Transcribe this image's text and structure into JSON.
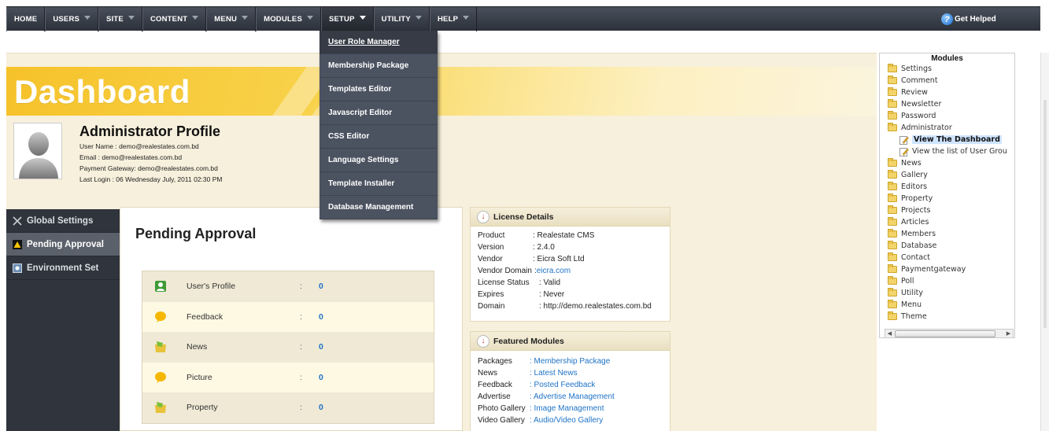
{
  "nav": {
    "items": [
      {
        "label": "HOME",
        "caret": false
      },
      {
        "label": "USERS",
        "caret": true
      },
      {
        "label": "SITE",
        "caret": true
      },
      {
        "label": "CONTENT",
        "caret": true
      },
      {
        "label": "MENU",
        "caret": true
      },
      {
        "label": "MODULES",
        "caret": true
      },
      {
        "label": "SETUP",
        "caret": true,
        "active": true
      },
      {
        "label": "UTILITY",
        "caret": true
      },
      {
        "label": "HELP",
        "caret": true
      }
    ],
    "help_label": "Get Helped"
  },
  "setup_menu": {
    "items": [
      "User Role Manager",
      "Membership Package",
      "Templates Editor",
      "Javascript Editor",
      "CSS Editor",
      "Language Settings",
      "Template Installer",
      "Database Management"
    ],
    "hovered_index": 0
  },
  "dashboard": {
    "title": "Dashboard",
    "profile_title": "Administrator Profile",
    "profile_lines": [
      "User Name : demo@realestates.com.bd",
      "Email : demo@realestates.com.bd",
      "Payment Gateway: demo@realestates.com.bd",
      "Last Login : 06 Wednesday July, 2011 02:30 PM"
    ]
  },
  "side_menu": {
    "items": [
      {
        "label": "Global Settings",
        "icon": "tools-icon"
      },
      {
        "label": "Pending Approval",
        "icon": "warning-icon",
        "active": true
      },
      {
        "label": "Environment Set",
        "icon": "environment-icon"
      }
    ]
  },
  "pending": {
    "title": "Pending Approval",
    "rows": [
      {
        "label": "User's Profile",
        "count": "0",
        "icon": "user-profile-icon"
      },
      {
        "label": "Feedback",
        "count": "0",
        "icon": "feedback-icon"
      },
      {
        "label": "News",
        "count": "0",
        "icon": "news-icon"
      },
      {
        "label": "Picture",
        "count": "0",
        "icon": "picture-icon"
      },
      {
        "label": "Property",
        "count": "0",
        "icon": "property-icon"
      }
    ],
    "colon": ":"
  },
  "license": {
    "title": "License Details",
    "rows": [
      {
        "k": "Product",
        "v": ": Realestate CMS"
      },
      {
        "k": "Version",
        "v": ": 2.4.0"
      },
      {
        "k": "Vendor",
        "v": ": Eicra Soft Ltd"
      },
      {
        "k": "Vendor Domain",
        "v": ": ",
        "link": "eicra.com"
      },
      {
        "k": "License Status",
        "v": ": Valid"
      },
      {
        "k": "Expires",
        "v": ": Never"
      },
      {
        "k": "Domain",
        "v": ": http://demo.realestates.com.bd"
      }
    ]
  },
  "featured": {
    "title": "Featured Modules",
    "rows": [
      {
        "k": "Packages",
        "v": ": Membership Package"
      },
      {
        "k": "News",
        "v": ": Latest News"
      },
      {
        "k": "Feedback",
        "v": ": Posted Feedback"
      },
      {
        "k": "Advertise",
        "v": ": Advertise Management"
      },
      {
        "k": "Photo Gallery",
        "v": ": Image Management"
      },
      {
        "k": "Video Gallery",
        "v": ": Audio/Video Gallery"
      }
    ]
  },
  "modules_tree": {
    "title": "Modules",
    "items": [
      {
        "label": "Settings",
        "type": "folder"
      },
      {
        "label": "Comment",
        "type": "folder"
      },
      {
        "label": "Review",
        "type": "folder"
      },
      {
        "label": "Newsletter",
        "type": "folder"
      },
      {
        "label": "Password",
        "type": "folder"
      },
      {
        "label": "Administrator",
        "type": "folder-open"
      },
      {
        "label": "View The Dashboard",
        "type": "child",
        "selected": true
      },
      {
        "label": "View the list of User Grou",
        "type": "child"
      },
      {
        "label": "News",
        "type": "folder"
      },
      {
        "label": "Gallery",
        "type": "folder"
      },
      {
        "label": "Editors",
        "type": "folder"
      },
      {
        "label": "Property",
        "type": "folder"
      },
      {
        "label": "Projects",
        "type": "folder"
      },
      {
        "label": "Articles",
        "type": "folder"
      },
      {
        "label": "Members",
        "type": "folder"
      },
      {
        "label": "Database",
        "type": "folder"
      },
      {
        "label": "Contact",
        "type": "folder"
      },
      {
        "label": "Paymentgateway",
        "type": "folder"
      },
      {
        "label": "Poll",
        "type": "folder"
      },
      {
        "label": "Utility",
        "type": "folder"
      },
      {
        "label": "Menu",
        "type": "folder"
      },
      {
        "label": "Theme",
        "type": "folder"
      }
    ]
  },
  "colors": {
    "nav_bg": "#2c313a",
    "banner": "#f6c22a",
    "link": "#1f73c6",
    "side_menu_bg": "#2f343d"
  }
}
